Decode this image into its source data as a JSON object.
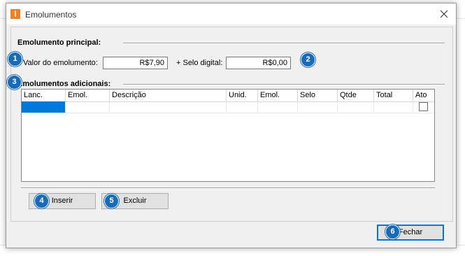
{
  "window": {
    "title": "Emolumentos",
    "app_icon_letter": "I"
  },
  "main_group": {
    "label": "Emolumento principal:",
    "valor_label": "Valor do emolumento:",
    "valor_value": "R$7,90",
    "selo_label": "+ Selo digital:",
    "selo_value": "R$0,00"
  },
  "additional_group": {
    "label": "Emolumentos adicionais:",
    "columns": [
      "Lanc.",
      "Emol.",
      "Descrição",
      "Unid.",
      "Emol.",
      "Selo",
      "Qtde",
      "Total",
      "Ato"
    ]
  },
  "buttons": {
    "insert": "Inserir",
    "delete": "Excluir",
    "close": "Fechar"
  },
  "badges": [
    "1",
    "2",
    "3",
    "4",
    "5",
    "6"
  ],
  "colors": {
    "accent": "#0078d7",
    "badge": "#1a6bb5",
    "app_icon": "#f47f20"
  }
}
